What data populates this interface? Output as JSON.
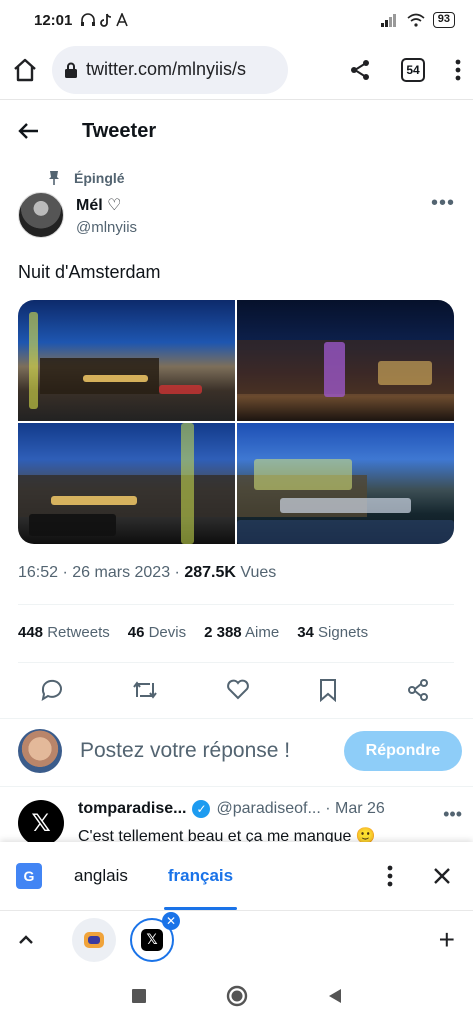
{
  "status": {
    "time": "12:01",
    "battery": "93"
  },
  "browser": {
    "url": "twitter.com/mlnyiis/s",
    "tab_count": "54"
  },
  "header": {
    "title": "Tweeter"
  },
  "tweet": {
    "pinned_label": "Épinglé",
    "author_name": "Mél ♡",
    "author_handle": "@mlnyiis",
    "text": "Nuit d'Amsterdam",
    "time": "16:52",
    "date": "26 mars 2023",
    "views_count": "287.5K",
    "views_label": "Vues",
    "stats": [
      {
        "count": "448",
        "label": "Retweets"
      },
      {
        "count": "46",
        "label": "Devis"
      },
      {
        "count": "2 388",
        "label": "Aime"
      },
      {
        "count": "34",
        "label": "Signets"
      }
    ]
  },
  "reply_box": {
    "placeholder": "Postez votre réponse !",
    "button_label": "Répondre"
  },
  "reply_tweet": {
    "name": "tomparadise...",
    "handle": "@paradiseof...",
    "date": "Mar 26",
    "text": "C'est tellement beau et ça me manque 🙂"
  },
  "translate": {
    "source_lang": "anglais",
    "target_lang": "français"
  },
  "colors": {
    "accent": "#1d9bf0",
    "reply_button": "#8ecdf8",
    "translate_active": "#1a73e8"
  }
}
